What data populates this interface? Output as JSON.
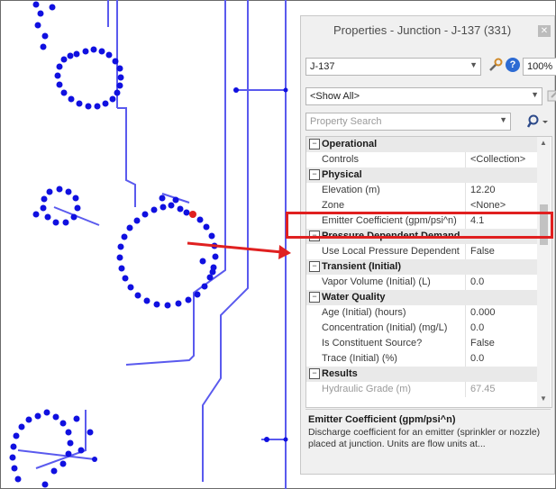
{
  "panel": {
    "title": "Properties - Junction - J-137 (331)",
    "element_combo": "J-137",
    "zoom_combo": "100%",
    "filter_combo": "<Show All>",
    "search_placeholder": "Property Search"
  },
  "grid": {
    "rows": [
      {
        "kind": "cat",
        "name": "Operational"
      },
      {
        "kind": "prop",
        "name": "Controls",
        "value": "<Collection>"
      },
      {
        "kind": "cat",
        "name": "Physical"
      },
      {
        "kind": "prop",
        "name": "Elevation (m)",
        "value": "12.20"
      },
      {
        "kind": "prop",
        "name": "Zone",
        "value": "<None>"
      },
      {
        "kind": "prop",
        "name": "Emitter Coefficient (gpm/psi^n)",
        "value": "4.1",
        "selected": true
      },
      {
        "kind": "cat",
        "name": "Pressure Dependent Demand"
      },
      {
        "kind": "prop",
        "name": "Use Local Pressure Dependent",
        "value": "False"
      },
      {
        "kind": "cat",
        "name": "Transient (Initial)"
      },
      {
        "kind": "prop",
        "name": "Vapor Volume (Initial) (L)",
        "value": "0.0"
      },
      {
        "kind": "cat",
        "name": "Water Quality"
      },
      {
        "kind": "prop",
        "name": "Age (Initial) (hours)",
        "value": "0.000"
      },
      {
        "kind": "prop",
        "name": "Concentration (Initial) (mg/L)",
        "value": "0.0"
      },
      {
        "kind": "prop",
        "name": "Is Constituent Source?",
        "value": "False"
      },
      {
        "kind": "prop",
        "name": "Trace (Initial) (%)",
        "value": "0.0"
      },
      {
        "kind": "cat",
        "name": "Results"
      },
      {
        "kind": "prop",
        "name": "Hydraulic Grade (m)",
        "value": "67.45",
        "greyed": true
      }
    ]
  },
  "description": {
    "title": "Emitter Coefficient (gpm/psi^n)",
    "body": "Discharge coefficient for an emitter (sprinkler or nozzle) placed at junction. Units are flow units at..."
  },
  "colors": {
    "node": "#1010e0",
    "pipe": "#5a5aee",
    "selected_node": "#e02020",
    "callout": "#e02020"
  }
}
